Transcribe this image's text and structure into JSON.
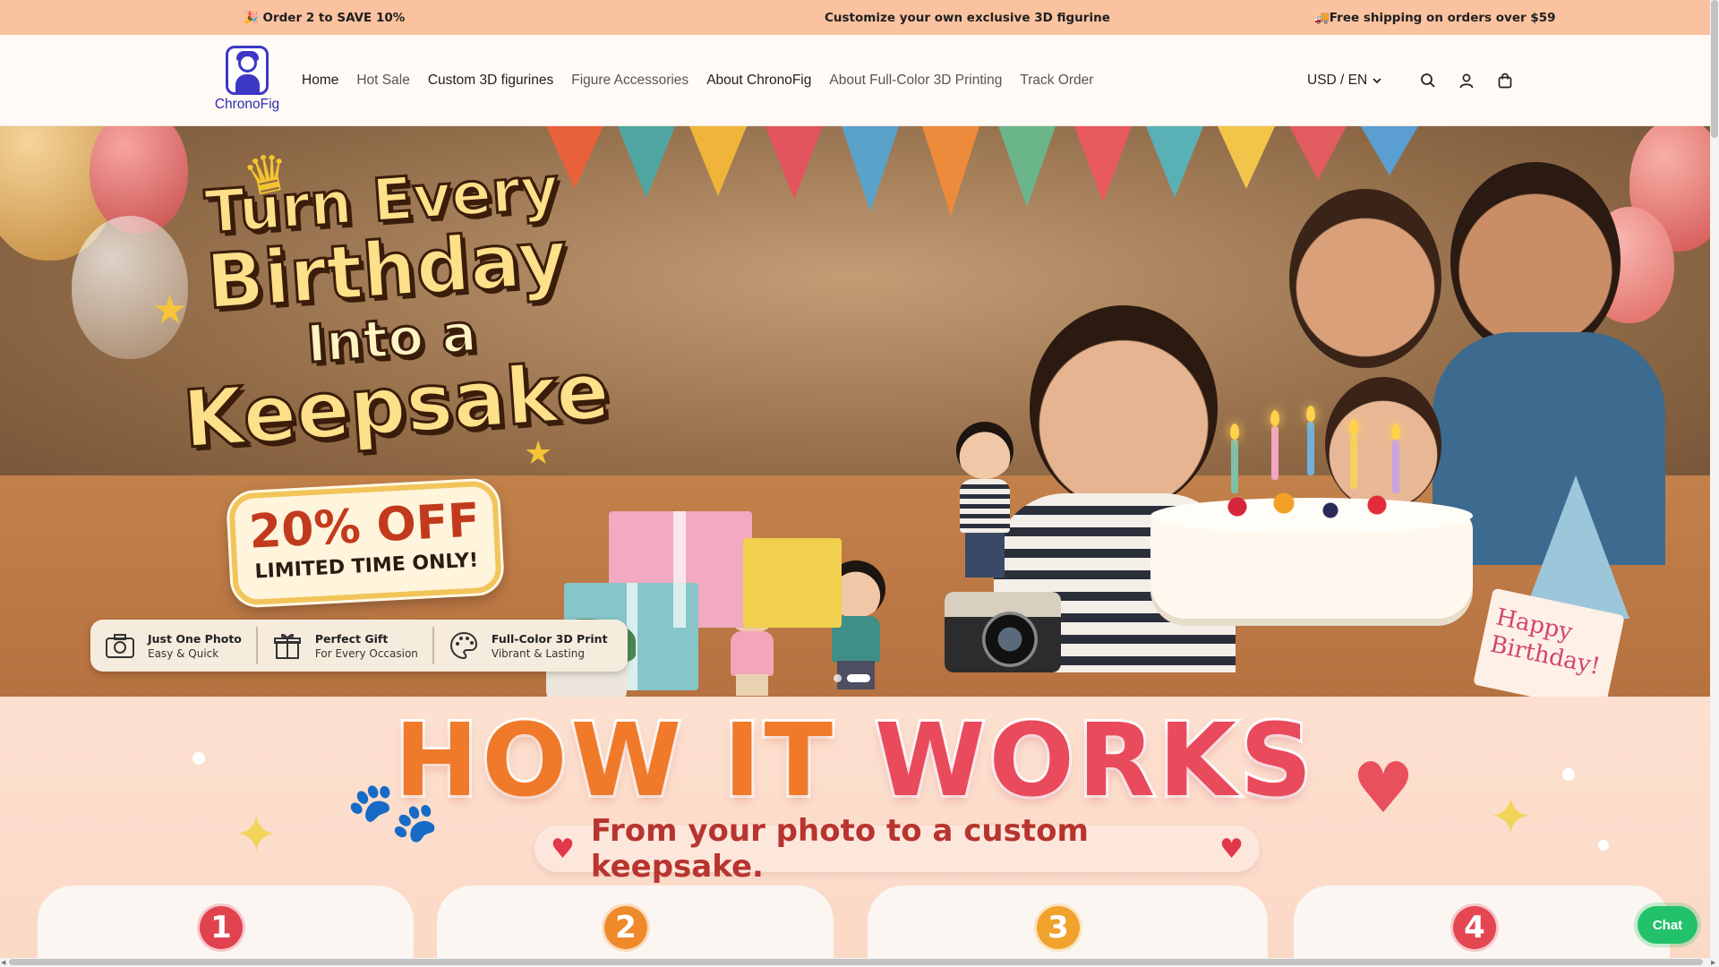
{
  "announcement": {
    "left": "🎉 Order 2 to SAVE 10%",
    "center": "Customize your own exclusive 3D figurine",
    "right": "🚚Free shipping on orders over $59"
  },
  "header": {
    "logo_text": "ChronoFig",
    "nav": [
      "Home",
      "Hot Sale",
      "Custom 3D figurines",
      "Figure Accessories",
      "About ChronoFig",
      "About Full-Color 3D Printing",
      "Track Order"
    ],
    "currency": "USD / EN",
    "icons": [
      "search-icon",
      "account-icon",
      "cart-icon"
    ]
  },
  "hero": {
    "headline": [
      "Turn Every",
      "Birthday",
      "Into a",
      "Keepsake"
    ],
    "promo_main": "20% OFF",
    "promo_sub": "LIMITED TIME ONLY!",
    "card_text": [
      "Happy",
      "Birthday!"
    ],
    "features": [
      {
        "title": "Just One Photo",
        "subtitle": "Easy & Quick",
        "icon": "camera-icon"
      },
      {
        "title": "Perfect Gift",
        "subtitle": "For Every Occasion",
        "icon": "gift-icon"
      },
      {
        "title": "Full-Color 3D Print",
        "subtitle": "Vibrant & Lasting",
        "icon": "palette-icon"
      }
    ],
    "slides_total": 2,
    "active_slide": 2
  },
  "how": {
    "title_word1": "HOW IT",
    "title_word2": "WORKS",
    "subtitle": "From your photo to a custom keepsake.",
    "steps": [
      "1",
      "2",
      "3",
      "4"
    ]
  },
  "chat_label": "Chat",
  "colors": {
    "announcement_bg": "#fbc2a0",
    "header_bg": "#fffaf5",
    "logo_blue": "#3c38c4",
    "chat_green": "#22c26b",
    "step_colors": [
      "#e0434e",
      "#ef8a2b",
      "#f0a22c",
      "#e44652"
    ]
  }
}
